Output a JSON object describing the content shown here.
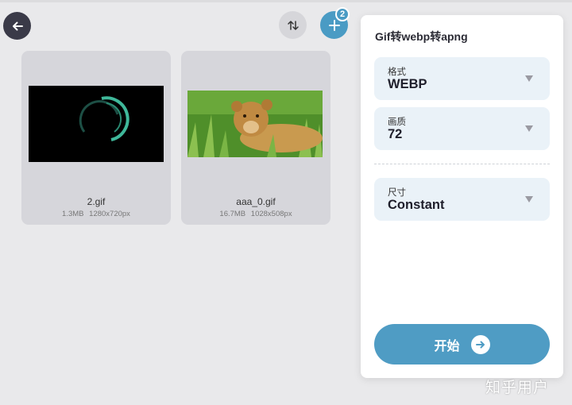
{
  "toolbar": {
    "back_icon": "arrow-left-icon",
    "sort_icon": "sort-arrows-icon",
    "add_icon": "plus-icon",
    "add_badge_count": "2"
  },
  "files": [
    {
      "name": "2.gif",
      "size": "1.3MB",
      "dimensions": "1280x720px"
    },
    {
      "name": "aaa_0.gif",
      "size": "16.7MB",
      "dimensions": "1028x508px"
    }
  ],
  "panel": {
    "title": "Gif转webp转apng",
    "format": {
      "label": "格式",
      "value": "WEBP"
    },
    "quality": {
      "label": "画质",
      "value": "72"
    },
    "size": {
      "label": "尺寸",
      "value": "Constant"
    },
    "start_label": "开始"
  },
  "watermark": "知乎用户",
  "colors": {
    "accent": "#4a9bc4",
    "back_button": "#3a3a48",
    "field_bg": "#eaf2f8"
  }
}
